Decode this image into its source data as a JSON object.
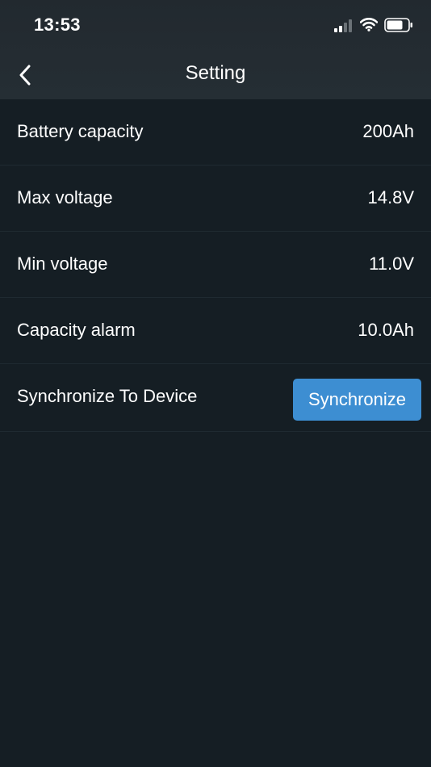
{
  "status_bar": {
    "time": "13:53",
    "icons": [
      "signal-icon",
      "wifi-icon",
      "battery-icon"
    ]
  },
  "nav": {
    "back_icon": "chevron-left-icon",
    "title": "Setting"
  },
  "settings": [
    {
      "label": "Battery capacity",
      "value": "200Ah"
    },
    {
      "label": "Max voltage",
      "value": "14.8V"
    },
    {
      "label": "Min voltage",
      "value": "11.0V"
    },
    {
      "label": "Capacity alarm",
      "value": "10.0Ah"
    }
  ],
  "sync": {
    "label": "Synchronize To Device",
    "button_label": "Synchronize"
  },
  "colors": {
    "background": "#151e24",
    "header": "#252e34",
    "divider": "#1f2a31",
    "accent": "#3d8ed2",
    "text": "#ffffff"
  }
}
